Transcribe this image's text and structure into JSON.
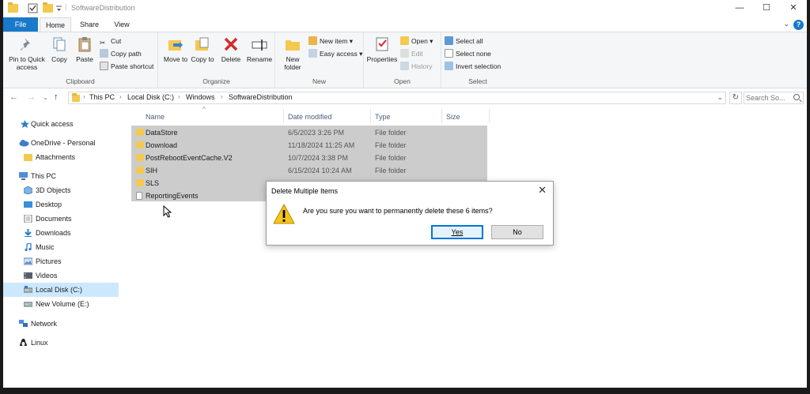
{
  "window": {
    "title": "SoftwareDistribution",
    "controls": {
      "minimize": "—",
      "maximize": "☐",
      "close": "✕"
    }
  },
  "tabs": [
    "File",
    "Home",
    "Share",
    "View"
  ],
  "ribbon": {
    "clipboard": {
      "label": "Clipboard",
      "pin": "Pin to Quick access",
      "copy": "Copy",
      "paste": "Paste",
      "cut": "Cut",
      "copy_path": "Copy path",
      "paste_shortcut": "Paste shortcut"
    },
    "organize": {
      "label": "Organize",
      "move_to": "Move to",
      "copy_to": "Copy to",
      "delete": "Delete",
      "rename": "Rename"
    },
    "new": {
      "label": "New",
      "new_folder": "New folder",
      "new_item": "New item",
      "easy_access": "Easy access"
    },
    "open": {
      "label": "Open",
      "properties": "Properties",
      "open": "Open",
      "edit": "Edit",
      "history": "History"
    },
    "select": {
      "label": "Select",
      "select_all": "Select all",
      "select_none": "Select none",
      "invert": "Invert selection"
    }
  },
  "address": {
    "crumbs": [
      "This PC",
      "Local Disk (C:)",
      "Windows",
      "SoftwareDistribution"
    ],
    "search_placeholder": "Search So..."
  },
  "nav": [
    {
      "label": "Quick access",
      "icon": "star-icon"
    },
    {
      "label": "OneDrive - Personal",
      "icon": "cloud-icon"
    },
    {
      "label": "Attachments",
      "icon": "folder-icon"
    },
    {
      "label": "This PC",
      "icon": "computer-icon"
    },
    {
      "label": "3D Objects",
      "icon": "cube-icon"
    },
    {
      "label": "Desktop",
      "icon": "desktop-icon"
    },
    {
      "label": "Documents",
      "icon": "document-icon"
    },
    {
      "label": "Downloads",
      "icon": "download-icon"
    },
    {
      "label": "Music",
      "icon": "music-icon"
    },
    {
      "label": "Pictures",
      "icon": "picture-icon"
    },
    {
      "label": "Videos",
      "icon": "video-icon"
    },
    {
      "label": "Local Disk (C:)",
      "icon": "drive-icon"
    },
    {
      "label": "New Volume (E:)",
      "icon": "drive-icon"
    },
    {
      "label": "Network",
      "icon": "network-icon"
    },
    {
      "label": "Linux",
      "icon": "linux-icon"
    }
  ],
  "columns": {
    "name": "Name",
    "date": "Date modified",
    "type": "Type",
    "size": "Size"
  },
  "files": [
    {
      "name": "DataStore",
      "date": "6/5/2023 3:26 PM",
      "type": "File folder"
    },
    {
      "name": "Download",
      "date": "11/18/2024 11:25 AM",
      "type": "File folder"
    },
    {
      "name": "PostRebootEventCache.V2",
      "date": "10/7/2024 3:38 PM",
      "type": "File folder"
    },
    {
      "name": "SIH",
      "date": "6/15/2024 10:24 AM",
      "type": "File folder"
    },
    {
      "name": "SLS",
      "date": "",
      "type": ""
    },
    {
      "name": "ReportingEvents",
      "date": "",
      "type": ""
    }
  ],
  "dialog": {
    "title": "Delete Multiple Items",
    "message": "Are you sure you want to permanently delete these 6 items?",
    "yes": "Yes",
    "no": "No",
    "close": "✕"
  },
  "colors": {
    "accent": "#1979ca",
    "selection": "#cccccc",
    "nav_selected": "#cce8ff"
  }
}
